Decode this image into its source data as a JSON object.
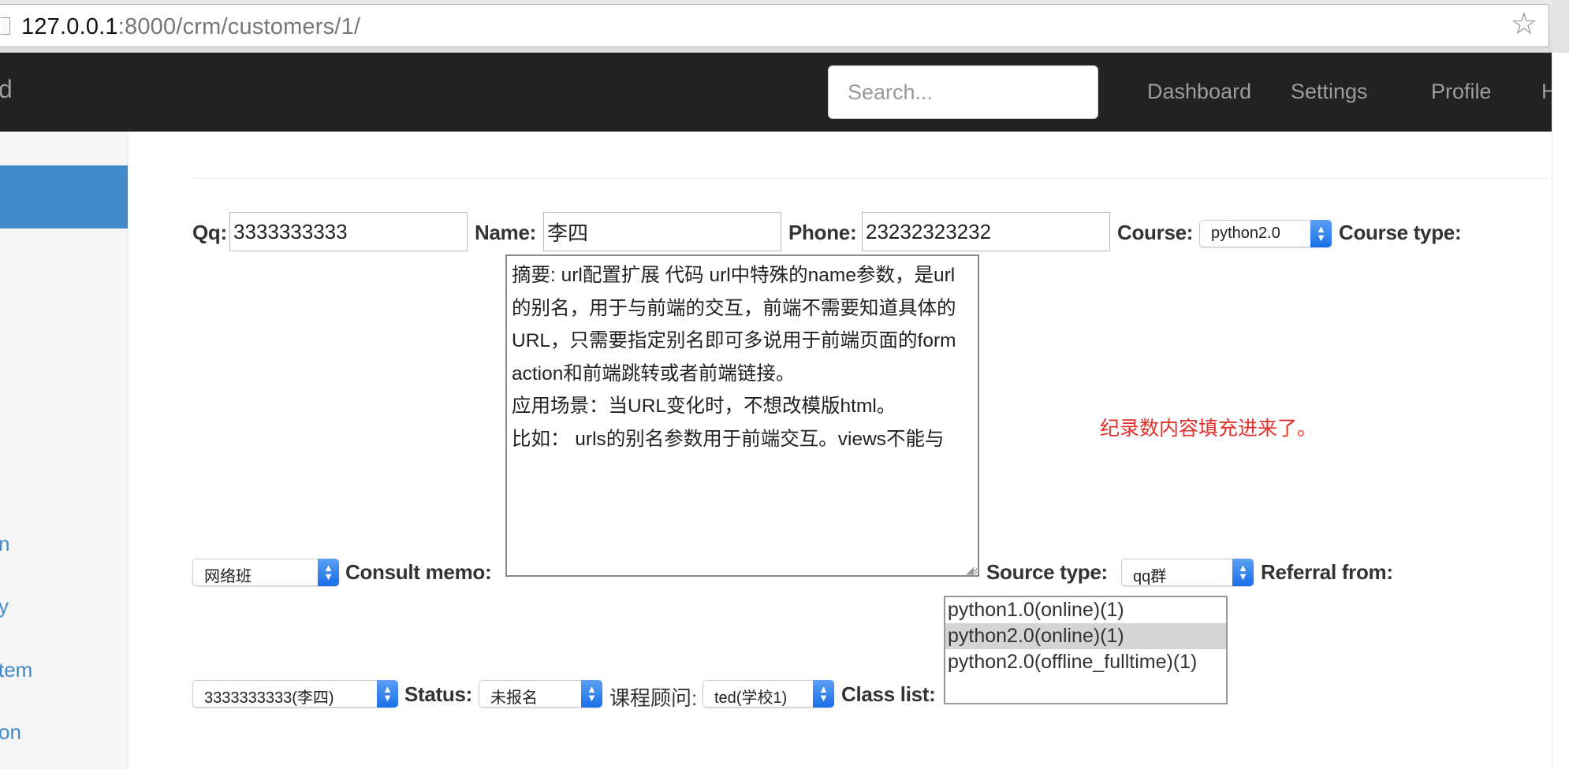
{
  "browser": {
    "url_host": "127.0.0.1",
    "url_rest": ":8000/crm/customers/1/"
  },
  "navbar": {
    "brand_partial": "d",
    "search_placeholder": "Search...",
    "links": [
      "Dashboard",
      "Settings",
      "Profile",
      "He"
    ]
  },
  "sidebar": {
    "items": [
      "n",
      "y",
      "tem",
      "on"
    ]
  },
  "form": {
    "qq_label": "Qq:",
    "qq_value": "3333333333",
    "name_label": "Name:",
    "name_value": "李四",
    "phone_label": "Phone:",
    "phone_value": "23232323232",
    "course_label": "Course:",
    "course_value": "python2.0",
    "course_type_label": "Course type:",
    "course_type_value": "网络班",
    "consult_memo_label": "Consult memo:",
    "consult_memo_value": "摘要: url配置扩展 代码 url中特殊的name参数，是url的别名，用于与前端的交互，前端不需要知道具体的URL，只需要指定别名即可多说用于前端页面的form action和前端跳转或者前端链接。\n应用场景：当URL变化时，不想改模版html。\n比如： urls的别名参数用于前端交互。views不能与",
    "source_type_label": "Source type:",
    "source_type_value": "qq群",
    "referral_from_label": "Referral from:",
    "referral_from_value": "3333333333(李四)",
    "status_label": "Status:",
    "status_value": "未报名",
    "consultant_label": "课程顾问:",
    "consultant_value": "ted(学校1)",
    "class_list_label": "Class list:",
    "class_list_options": [
      {
        "label": "python1.0(online)(1)",
        "selected": false
      },
      {
        "label": "python2.0(online)(1)",
        "selected": true
      },
      {
        "label": "python2.0(offline_fulltime)(1)",
        "selected": false
      }
    ]
  },
  "annotation": {
    "text": "纪录数内容填充进来了。",
    "color": "#e0312b"
  },
  "colors": {
    "navbar_bg": "#222222",
    "sidebar_active": "#428bca",
    "link": "#428bca"
  }
}
